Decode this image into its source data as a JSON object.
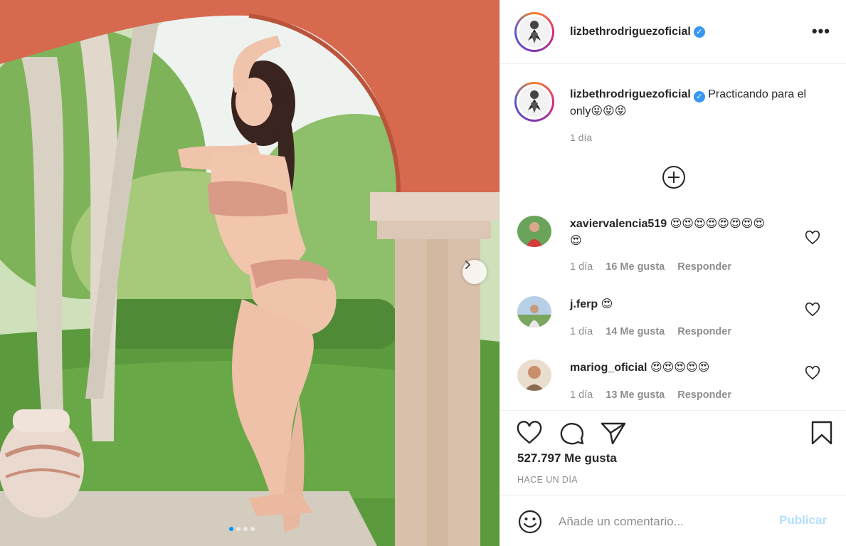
{
  "post": {
    "username": "lizbethrodriguezoficial",
    "verified_icon": "verified-badge-icon",
    "more_icon": "more-options-icon",
    "more_glyph": "•••",
    "carousel": {
      "current_index": 1,
      "total": 4,
      "next_icon": "chevron-right-icon"
    }
  },
  "caption": {
    "username": "lizbethrodriguezoficial",
    "text": "Practicando para el only😝😝😝",
    "time": "1 día"
  },
  "load_more_icon": "plus-circle-icon",
  "comments": [
    {
      "username": "xaviervalencia519",
      "text": "😍😍😍😍😍😍😍😍😍",
      "time": "1 día",
      "likes": "16 Me gusta",
      "reply": "Responder"
    },
    {
      "username": "j.ferp",
      "text": "😍",
      "time": "1 día",
      "likes": "14 Me gusta",
      "reply": "Responder"
    },
    {
      "username": "mariog_oficial",
      "text": "😍😍😍😍😍",
      "time": "1 día",
      "likes": "13 Me gusta",
      "reply": "Responder"
    }
  ],
  "actions": {
    "like_icon": "heart-icon",
    "comment_icon": "comment-bubble-icon",
    "share_icon": "paper-plane-icon",
    "save_icon": "bookmark-icon"
  },
  "likes_count": "527.797 Me gusta",
  "posted_ago": "HACE UN DÍA",
  "add_comment": {
    "emoji_icon": "smiley-icon",
    "placeholder": "Añade un comentario...",
    "publish_label": "Publicar"
  },
  "colors": {
    "text": "#262626",
    "muted": "#8e8e8e",
    "link_disabled": "#b2dffc",
    "verified": "#3897f0",
    "divider": "#efefef"
  }
}
